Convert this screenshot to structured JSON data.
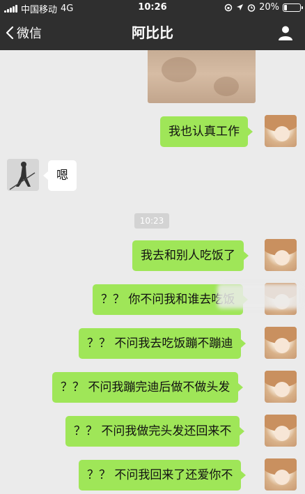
{
  "status_bar": {
    "carrier": "中国移动",
    "network": "4G",
    "time": "10:26",
    "battery_percent": "20%",
    "battery_level": 0.2
  },
  "nav": {
    "back_label": "微信",
    "title": "阿比比",
    "profile_icon": "person-icon"
  },
  "timestamp": "10:23",
  "messages": [
    {
      "from": "me",
      "text": "我也认真工作"
    },
    {
      "from": "other",
      "text": "嗯"
    },
    {
      "from": "me",
      "text": "我去和别人吃饭了"
    },
    {
      "from": "me",
      "text": "？？ 你不问我和谁去吃饭"
    },
    {
      "from": "me",
      "text": "？？ 不问我去吃饭蹦不蹦迪"
    },
    {
      "from": "me",
      "text": "？？ 不问我蹦完迪后做不做头发"
    },
    {
      "from": "me",
      "text": "？？ 不问我做完头发还回来不"
    },
    {
      "from": "me",
      "text": "？？ 不问我回来了还爱你不"
    }
  ],
  "colors": {
    "header": "#2f2f2f",
    "chat_bg": "#ebebeb",
    "my_bubble": "#9fe658",
    "other_bubble": "#ffffff"
  }
}
